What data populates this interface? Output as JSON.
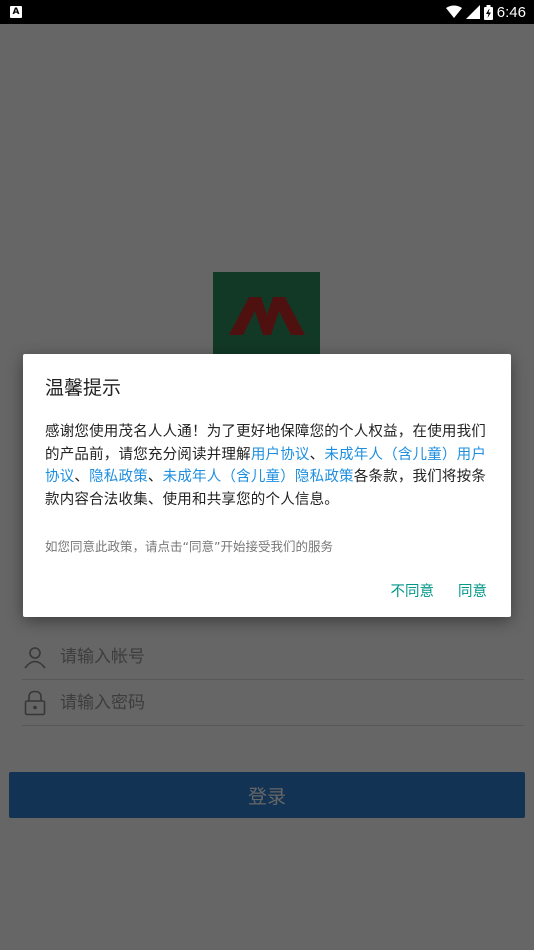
{
  "status_bar": {
    "notification_glyph": "A",
    "time": "6:46"
  },
  "login": {
    "username_placeholder": "请输入帐号",
    "password_placeholder": "请输入密码",
    "login_button": "登录"
  },
  "dialog": {
    "title": "温馨提示",
    "body": {
      "text1": "感谢您使用茂名人人通！为了更好地保障您的个人权益，在使用我们的产品前，请您充分阅读并理解",
      "link1": "用户协议",
      "sep1": "、",
      "link2": "未成年人（含儿童）用户协议",
      "sep2": "、",
      "link3": "隐私政策",
      "sep3": "、",
      "link4": "未成年人（含儿童）隐私政策",
      "text2": "各条款，我们将按条款内容合法收集、使用和共享您的个人信息。"
    },
    "hint": "如您同意此政策，请点击“同意”开始接受我们的服务",
    "disagree_label": "不同意",
    "agree_label": "同意"
  },
  "colors": {
    "link": "#1e8fe0",
    "action": "#009688",
    "login_button": "#2d7fd1",
    "logo_bg": "#2f8f5d",
    "logo_mark": "#c62828"
  }
}
